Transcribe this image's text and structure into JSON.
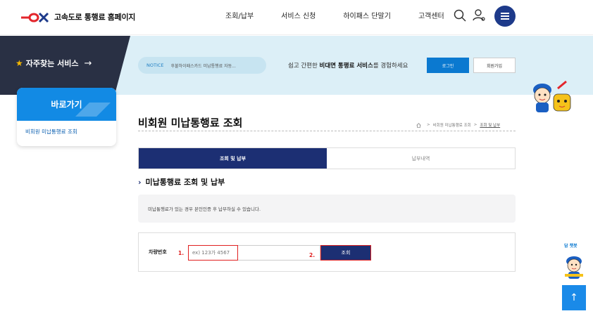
{
  "header": {
    "logo_text": "고속도로 통행료 홈페이지",
    "nav": [
      "조회/납부",
      "서비스 신청",
      "하이패스 단말기",
      "고객센터"
    ]
  },
  "banner": {
    "favorites_label": "자주찾는 서비스",
    "favorites_arrow": "→",
    "notice_tag": "NOTICE",
    "notice_text": "후불하이패스카드 미납통행료 자동...",
    "message_pre": "쉽고 간편한 ",
    "message_bold": "비대면 통행료 서비스",
    "message_post": "를 경험하세요",
    "login_label": "로그인",
    "join_label": "회원가입"
  },
  "shortcut": {
    "title": "바로가기",
    "link": "비회원 미납통행료 조회"
  },
  "page": {
    "title": "비회원 미납통행료 조회",
    "breadcrumb_sep": ">",
    "breadcrumb": [
      "비회원 미납통행료 조회",
      "조회 및 납부"
    ]
  },
  "tabs": [
    {
      "label": "조회 및 납부",
      "active": true
    },
    {
      "label": "납부내역",
      "active": false
    }
  ],
  "section": {
    "chevron": "›",
    "title": "미납통행료 조회 및 납부"
  },
  "info": "미납통행료가 있는 경우 본인인증 후 납부하실 수 있습니다.",
  "form": {
    "label": "차량번호",
    "step1": "1.",
    "placeholder": "ex) 123가 4567",
    "step2": "2.",
    "button": "조회"
  },
  "side": {
    "chatbot_label": "담 챗봇",
    "top_arrow": "↑"
  },
  "colors": {
    "primary_navy": "#1c2f73",
    "accent_blue": "#0b79d0",
    "highlight_red": "#e02020"
  }
}
